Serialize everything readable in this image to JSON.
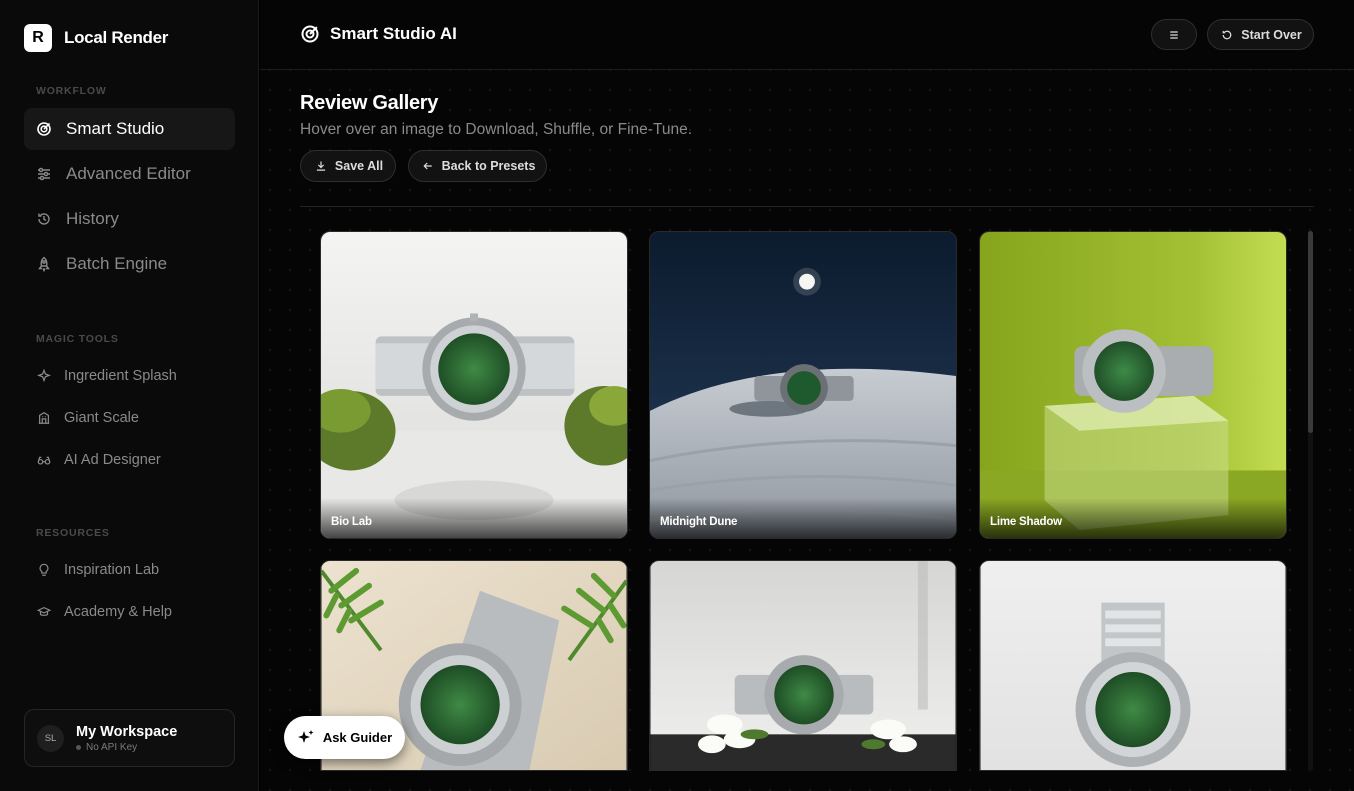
{
  "app": {
    "logo_letter": "R",
    "name": "Local Render"
  },
  "sidebar": {
    "workflow_label": "WORKFLOW",
    "workflow_items": [
      {
        "label": "Smart Studio",
        "icon": "target-icon",
        "active": true
      },
      {
        "label": "Advanced Editor",
        "icon": "sliders-icon",
        "active": false
      },
      {
        "label": "History",
        "icon": "history-icon",
        "active": false
      },
      {
        "label": "Batch Engine",
        "icon": "rocket-icon",
        "active": false
      }
    ],
    "magic_label": "MAGIC TOOLS",
    "magic_items": [
      {
        "label": "Ingredient Splash",
        "icon": "sparkle-icon"
      },
      {
        "label": "Giant Scale",
        "icon": "building-icon"
      },
      {
        "label": "AI Ad Designer",
        "icon": "glasses-icon"
      }
    ],
    "resources_label": "RESOURCES",
    "resource_items": [
      {
        "label": "Inspiration Lab",
        "icon": "lightbulb-icon"
      },
      {
        "label": "Academy & Help",
        "icon": "graduation-cap-icon"
      }
    ],
    "workspace": {
      "initials": "SL",
      "name": "My Workspace",
      "status": "No API Key"
    }
  },
  "header": {
    "title": "Smart Studio AI",
    "start_over_label": "Start Over"
  },
  "gallery": {
    "title": "Review Gallery",
    "subtitle": "Hover over an image to Download, Shuffle, or Fine-Tune.",
    "save_all_label": "Save All",
    "back_label": "Back to Presets",
    "cards": [
      {
        "caption": "Bio Lab",
        "scene": "white-moss"
      },
      {
        "caption": "Midnight Dune",
        "scene": "night-dune"
      },
      {
        "caption": "Lime Shadow",
        "scene": "lime-cube"
      },
      {
        "caption": "",
        "scene": "fern-beige"
      },
      {
        "caption": "",
        "scene": "white-flowers"
      },
      {
        "caption": "",
        "scene": "white-studio"
      }
    ]
  },
  "guider": {
    "label": "Ask Guider"
  },
  "colors": {
    "accent": "#ffffff",
    "background": "#050505",
    "dial_green": "#2f6e35"
  }
}
